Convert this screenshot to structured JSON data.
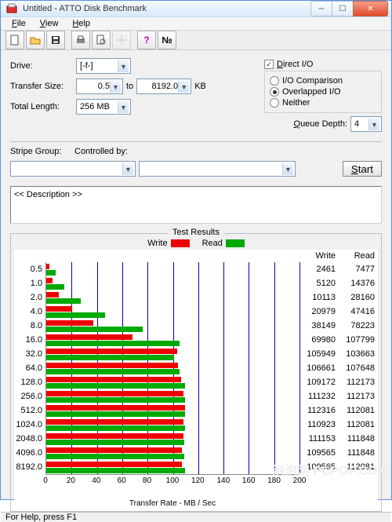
{
  "window": {
    "title": "Untitled - ATTO Disk Benchmark"
  },
  "menu": {
    "file": "File",
    "view": "View",
    "help": "Help"
  },
  "labels": {
    "drive": "Drive:",
    "transfer_size": "Transfer Size:",
    "to": "to",
    "kb": "KB",
    "total_length": "Total Length:",
    "direct_io": "Direct I/O",
    "io_comparison": "I/O Comparison",
    "overlapped_io": "Overlapped I/O",
    "neither": "Neither",
    "queue_depth": "Queue Depth:",
    "stripe_group": "Stripe Group:",
    "controlled_by": "Controlled by:",
    "start": "Start",
    "description": "<< Description >>",
    "test_results": "Test Results",
    "write": "Write",
    "read": "Read",
    "transfer_rate": "Transfer Rate - MB / Sec",
    "status": "For Help, press F1"
  },
  "values": {
    "drive": "[-f-]",
    "ts_from": "0.5",
    "ts_to": "8192.0",
    "total_length": "256 MB",
    "queue_depth": "4"
  },
  "colors": {
    "write": "#e00000",
    "read": "#00a000"
  },
  "chart_data": {
    "type": "bar",
    "xlabel": "Transfer Rate - MB / Sec",
    "xlim": [
      0,
      200
    ],
    "xticks": [
      0,
      20,
      40,
      60,
      80,
      100,
      120,
      140,
      160,
      180,
      200
    ],
    "series_names": [
      "Write",
      "Read"
    ],
    "categories": [
      "0.5",
      "1.0",
      "2.0",
      "4.0",
      "8.0",
      "16.0",
      "32.0",
      "64.0",
      "128.0",
      "256.0",
      "512.0",
      "1024.0",
      "2048.0",
      "4096.0",
      "8192.0"
    ],
    "write_kb": [
      2461,
      5120,
      10113,
      20979,
      38149,
      69980,
      105949,
      106661,
      109172,
      111232,
      112316,
      110923,
      111153,
      109565,
      109565
    ],
    "read_kb": [
      7477,
      14376,
      28160,
      47416,
      78223,
      107799,
      103663,
      107648,
      112173,
      112173,
      112081,
      112081,
      111848,
      111848,
      112081
    ],
    "write_mb": [
      2.4,
      5.0,
      9.88,
      20.49,
      37.25,
      68.34,
      103.47,
      104.16,
      106.61,
      108.63,
      109.68,
      108.32,
      108.55,
      107.0,
      107.0
    ],
    "read_mb": [
      7.3,
      14.04,
      27.5,
      46.3,
      76.39,
      105.27,
      101.23,
      105.13,
      109.54,
      109.54,
      109.45,
      109.45,
      109.23,
      109.23,
      109.45
    ]
  },
  "watermark": "泡泡网 PCPOP.COM"
}
